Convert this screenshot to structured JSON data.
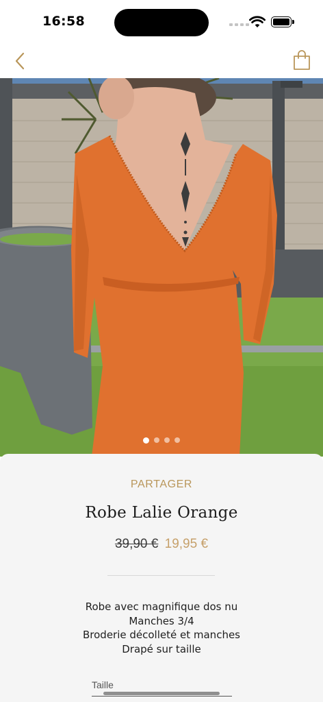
{
  "status_bar": {
    "time": "16:58",
    "icons": [
      "signal-icon",
      "wifi-icon",
      "battery-icon"
    ]
  },
  "nav": {
    "back_icon": "chevron-left-icon",
    "cart_icon": "shopping-bag-icon",
    "accent_color": "#b9965a"
  },
  "gallery": {
    "image_count": 4,
    "active_index": 0,
    "image_subject": "orange long-sleeve dress, open back view"
  },
  "product": {
    "share_label": "PARTAGER",
    "title": "Robe Lalie Orange",
    "old_price": "39,90 €",
    "new_price": "19,95 €",
    "description": [
      "Robe avec magnifique dos nu",
      "Manches 3/4",
      "Broderie décolleté et manches",
      "Drapé sur taille"
    ],
    "size_label": "Taille"
  },
  "colors": {
    "gold_accent": "#b9965a",
    "price_accent": "#c6a06a",
    "sheet_background": "#f5f5f5"
  }
}
